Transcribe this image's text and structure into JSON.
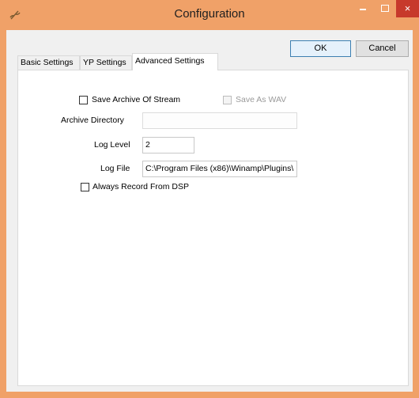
{
  "window": {
    "title": "Configuration",
    "close_glyph": "×",
    "colors": {
      "titlebar": "#f0a168",
      "close": "#c7392b"
    }
  },
  "buttons": {
    "ok": "OK",
    "cancel": "Cancel"
  },
  "tabs": [
    {
      "label": "Basic Settings",
      "active": false
    },
    {
      "label": "YP Settings",
      "active": false
    },
    {
      "label": "Advanced Settings",
      "active": true
    }
  ],
  "advanced": {
    "save_archive": {
      "label": "Save Archive Of Stream",
      "checked": false
    },
    "save_as_wav": {
      "label": "Save As WAV",
      "checked": false,
      "enabled": false
    },
    "archive_directory": {
      "label": "Archive Directory",
      "value": ""
    },
    "log_level": {
      "label": "Log Level",
      "value": "2"
    },
    "log_file": {
      "label": "Log File",
      "value": "C:\\Program Files (x86)\\Winamp\\Plugins\\"
    },
    "always_record": {
      "label": "Always Record From DSP",
      "checked": false
    }
  }
}
